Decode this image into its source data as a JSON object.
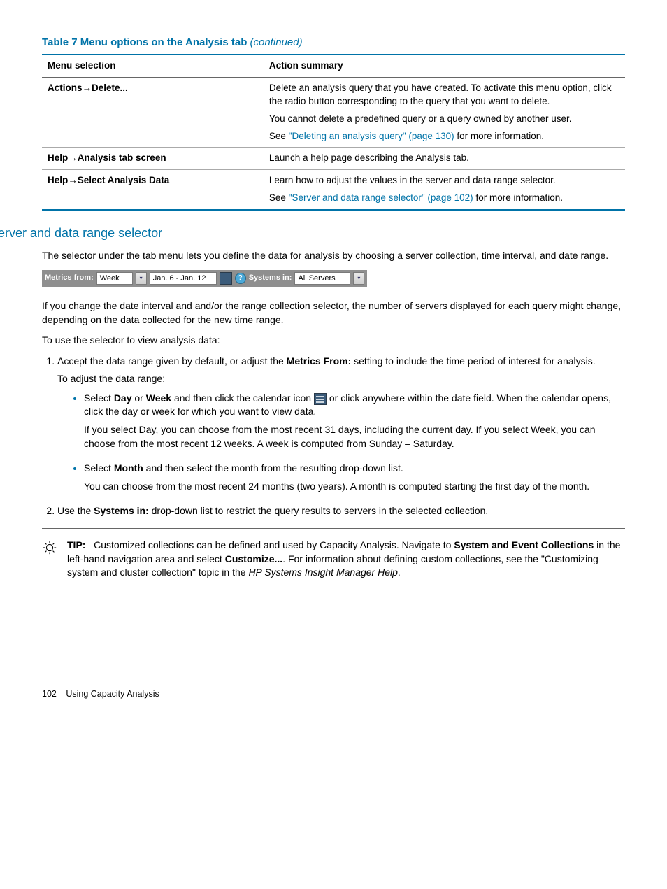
{
  "table": {
    "title_main": "Table 7 Menu options on the Analysis tab ",
    "title_cont": "(continued)",
    "headers": [
      "Menu selection",
      "Action summary"
    ],
    "rows": [
      {
        "menu": "Actions→Delete...",
        "p1": "Delete an analysis query that you have created. To activate this menu option, click the radio button corresponding to the query that you want to delete.",
        "p2": "You cannot delete a predefined query or a query owned by another user.",
        "p3a": "See ",
        "p3_link": "\"Deleting an analysis query\" (page 130)",
        "p3b": " for more information."
      },
      {
        "menu": "Help→Analysis tab screen",
        "p1": "Launch a help page describing the Analysis tab."
      },
      {
        "menu": "Help→Select Analysis Data",
        "p1": "Learn how to adjust the values in the server and data range selector.",
        "p2a": "See ",
        "p2_link": "\"Server and data range selector\" (page 102)",
        "p2b": " for more information."
      }
    ]
  },
  "section_heading": "Server and data range selector",
  "intro": "The selector under the tab menu lets you define the data for analysis by choosing a server collection, time interval, and date range.",
  "selector": {
    "metrics_label": "Metrics from:",
    "interval": "Week",
    "range": "Jan. 6 - Jan. 12",
    "help": "?",
    "systems_label": "Systems in:",
    "systems_value": "All Servers"
  },
  "after_selector": "If you change the date interval and and/or the range collection selector, the number of servers displayed for each query might change, depending on the data collected for the new time range.",
  "use_intro": "To use the selector to view analysis data:",
  "step1": {
    "text_a": "Accept the data range given by default, or adjust the ",
    "bold1": "Metrics From:",
    "text_b": " setting to include the time period of interest for analysis.",
    "adjust": "To adjust the data range:",
    "bullet1": {
      "a": "Select ",
      "b1": "Day",
      "mid": " or ",
      "b2": "Week",
      "c": " and then click the calendar icon ",
      "d": " or click anywhere within the date field. When the calendar opens, click the day or week for which you want to view data.",
      "p2": "If you select Day, you can choose from the most recent 31 days, including the current day. If you select Week, you can choose from the most recent 12 weeks. A week is computed from Sunday – Saturday."
    },
    "bullet2": {
      "a": "Select ",
      "b": "Month",
      "c": " and then select the month from the resulting drop-down list.",
      "p2": "You can choose from the most recent 24 months (two years). A month is computed starting the first day of the month."
    }
  },
  "step2": {
    "a": "Use the ",
    "b": "Systems in:",
    "c": " drop-down list to restrict the query results to servers in the selected collection."
  },
  "tip": {
    "label": "TIP:",
    "a": "Customized collections can be defined and used by Capacity Analysis. Navigate to ",
    "b1": "System and Event Collections",
    "mid": " in the left-hand navigation area and select ",
    "b2": "Customize...",
    "c": ". For information about defining custom collections, see the \"Customizing system and cluster collection\" topic in the ",
    "i": "HP Systems Insight Manager Help",
    "end": "."
  },
  "footer": {
    "page": "102",
    "label": "Using Capacity Analysis"
  }
}
